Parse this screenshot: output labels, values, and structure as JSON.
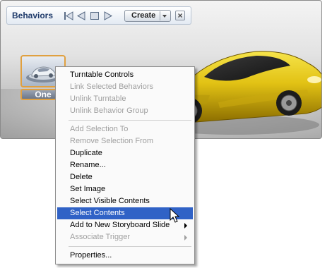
{
  "window": {
    "title": "Behaviors",
    "create_label": "Create",
    "icons": {
      "first": "skip-to-start-icon",
      "prev": "rewind-icon",
      "stop": "stop-icon",
      "play": "play-icon",
      "dropdown": "chevron-down-icon",
      "close": "close-icon"
    }
  },
  "behavior_item": {
    "label": "One",
    "thumbnail": "car-thumbnail-icon"
  },
  "context_menu": {
    "groups": [
      [
        {
          "label": "Turntable Controls",
          "enabled": true
        },
        {
          "label": "Link Selected Behaviors",
          "enabled": false
        },
        {
          "label": "Unlink Turntable",
          "enabled": false
        },
        {
          "label": "Unlink Behavior Group",
          "enabled": false
        }
      ],
      [
        {
          "label": "Add Selection To",
          "enabled": false
        },
        {
          "label": "Remove Selection From",
          "enabled": false
        },
        {
          "label": "Duplicate",
          "enabled": true
        },
        {
          "label": "Rename...",
          "enabled": true
        },
        {
          "label": "Delete",
          "enabled": true
        },
        {
          "label": "Set Image",
          "enabled": true
        },
        {
          "label": "Select Visible Contents",
          "enabled": true
        },
        {
          "label": "Select Contents",
          "enabled": true,
          "selected": true
        },
        {
          "label": "Add to New Storyboard Slide",
          "enabled": true,
          "submenu": true
        },
        {
          "label": "Associate Trigger",
          "enabled": false,
          "submenu": true
        }
      ],
      [
        {
          "label": "Properties...",
          "enabled": true
        }
      ]
    ]
  },
  "colors": {
    "selection": "#3062c6",
    "car_yellow": "#e8c81a",
    "thumb_border": "#e0a040"
  }
}
